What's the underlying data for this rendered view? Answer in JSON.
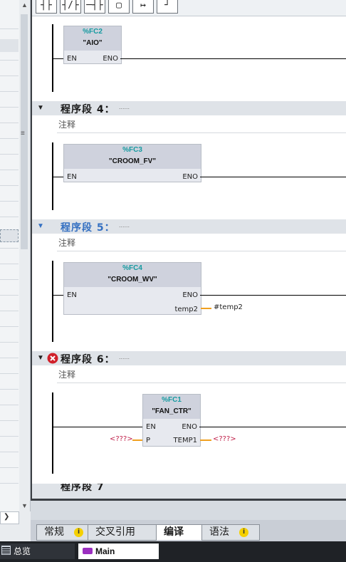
{
  "toolbar": {
    "buttons": [
      {
        "icon": "normally-open-contact-icon",
        "glyph": "┤├"
      },
      {
        "icon": "normally-closed-contact-icon",
        "glyph": "┤/├"
      },
      {
        "icon": "coil-icon",
        "glyph": "─┤├"
      },
      {
        "icon": "empty-box-icon",
        "glyph": "▢"
      },
      {
        "icon": "open-branch-icon",
        "glyph": "↦"
      },
      {
        "icon": "close-branch-icon",
        "glyph": "┘"
      }
    ]
  },
  "networks": [
    {
      "block": {
        "address": "%FC2",
        "name": "\"AIO\"",
        "en": "EN",
        "eno": "ENO"
      }
    },
    {
      "title": "程序段 4：",
      "dots": "......",
      "comment": "注释",
      "block": {
        "address": "%FC3",
        "name": "\"CROOM_FV\"",
        "en": "EN",
        "eno": "ENO"
      }
    },
    {
      "title": "程序段 5：",
      "dots": "......",
      "comment": "注释",
      "block": {
        "address": "%FC4",
        "name": "\"CROOM_WV\"",
        "en": "EN",
        "eno": "ENO",
        "out_pin": "temp2",
        "out_value": "#temp2"
      }
    },
    {
      "title": "程序段 6：",
      "dots": "......",
      "comment": "注释",
      "block": {
        "address": "%FC1",
        "name": "\"FAN_CTR\"",
        "en": "EN",
        "eno": "ENO",
        "in_pin": "P",
        "out_pin": "TEMP1",
        "in_value": "<???>",
        "out_value": "<???>"
      }
    }
  ],
  "next_network_partial": "程序段 7",
  "tabs": [
    {
      "label": "常规",
      "info": "i"
    },
    {
      "label": "交叉引用"
    },
    {
      "label": "编译"
    },
    {
      "label": "语法",
      "info": "i"
    }
  ],
  "statusbar": {
    "overview": "总览",
    "main": "Main"
  },
  "colors": {
    "accent": "#3470c2",
    "address": "#159aa0",
    "wire_orange": "#f0a020",
    "error": "#d0202a",
    "unknown_param": "#c0204a"
  }
}
